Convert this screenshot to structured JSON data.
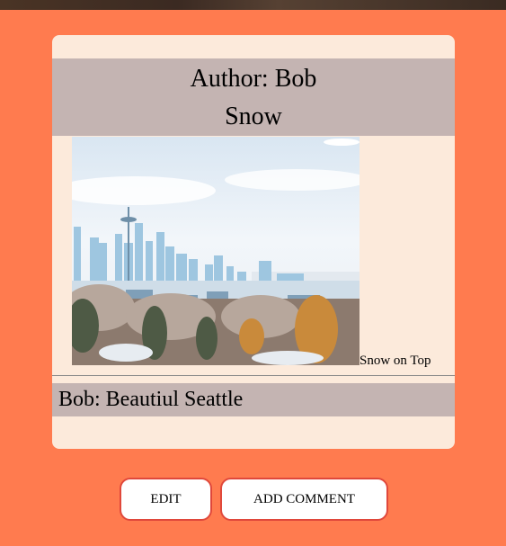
{
  "post": {
    "author_label": "Author: Bob",
    "title": "Snow",
    "image_caption": "Snow on Top",
    "comment": "Bob: Beautiul Seattle"
  },
  "actions": {
    "edit_label": "EDIT",
    "add_comment_label": "ADD COMMENT"
  },
  "colors": {
    "background": "#ff7b4f",
    "card": "#fceadb",
    "band": "#c4b4b2",
    "button_border": "#e0483b"
  }
}
